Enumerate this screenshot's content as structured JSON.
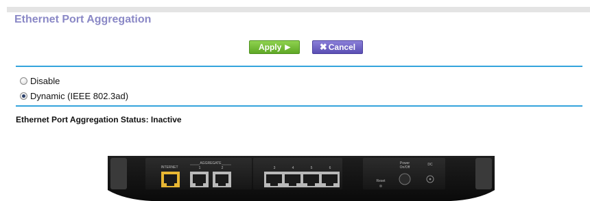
{
  "page": {
    "title": "Ethernet Port Aggregation"
  },
  "buttons": {
    "apply_label": "Apply",
    "cancel_label": "Cancel"
  },
  "options": [
    {
      "label": "Disable",
      "checked": false
    },
    {
      "label": "Dynamic (IEEE 802.3ad)",
      "checked": true
    }
  ],
  "status": {
    "text": "Ethernet Port Aggregation Status: Inactive"
  },
  "router": {
    "labels": {
      "internet": "INTERNET",
      "aggregate": "AGGREGATE",
      "port1": "1",
      "port2": "2",
      "port3": "3",
      "port4": "4",
      "port5": "5",
      "port6": "6",
      "reset": "Reset",
      "power_line1": "Power",
      "power_line2": "On/Off",
      "dc": "DC"
    }
  },
  "colors": {
    "title": "#8a88c6",
    "divider": "#33a3dc",
    "apply": "#6fbb34",
    "cancel": "#6b60c4",
    "internet_port": "#e8b733"
  }
}
